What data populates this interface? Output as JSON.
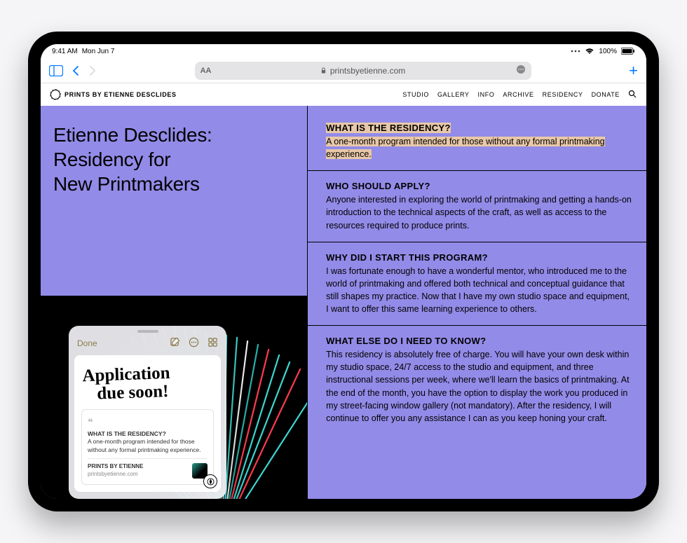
{
  "status": {
    "time": "9:41 AM",
    "date": "Mon Jun 7",
    "battery_pct": "100%"
  },
  "safari": {
    "url": "printsbyetienne.com",
    "aa_label": "AA"
  },
  "site": {
    "brand": "PRINTS BY ETIENNE DESCLIDES",
    "nav": {
      "studio": "STUDIO",
      "gallery": "GALLERY",
      "info": "INFO",
      "archive": "ARCHIVE",
      "residency": "RESIDENCY",
      "donate": "DONATE"
    }
  },
  "page": {
    "title_line1": "Etienne Desclides:",
    "title_line2": "Residency for",
    "title_line3": "New Printmakers"
  },
  "faq": [
    {
      "q": "WHAT IS THE RESIDENCY?",
      "a": "A one-month program intended for those without any formal printmaking experience."
    },
    {
      "q": "WHO SHOULD APPLY?",
      "a": "Anyone interested in exploring the world of printmaking and getting a hands-on introduction to the technical aspects of the craft, as well as access to the resources required to produce prints."
    },
    {
      "q": "WHY DID I START THIS PROGRAM?",
      "a": "I was fortunate enough to have a wonderful mentor, who introduced me to the world of printmaking and offered both technical and conceptual guidance that still shapes my practice. Now that I have my own studio space and equipment, I want to offer this same learning experience to others."
    },
    {
      "q": "WHAT ELSE DO I NEED TO KNOW?",
      "a": "This residency is absolutely free of charge. You will have your own desk within my studio space, 24/7 access to the studio and equipment, and three instructional sessions per week, where we'll learn the basics of printmaking. At the end of the month, you have the option to display the work you produced in my street-facing window gallery (not mandatory). After the residency, I will continue to offer you any assistance I can as you keep honing your craft."
    }
  ],
  "quicknote": {
    "done": "Done",
    "handwriting_line1": "Application",
    "handwriting_line2": "due soon!",
    "quote_title": "WHAT IS THE RESIDENCY?",
    "quote_body": "A one-month program intended for those without any formal printmaking experience.",
    "source_name": "PRINTS BY ETIENNE",
    "source_url": "printsbyetienne.com"
  }
}
